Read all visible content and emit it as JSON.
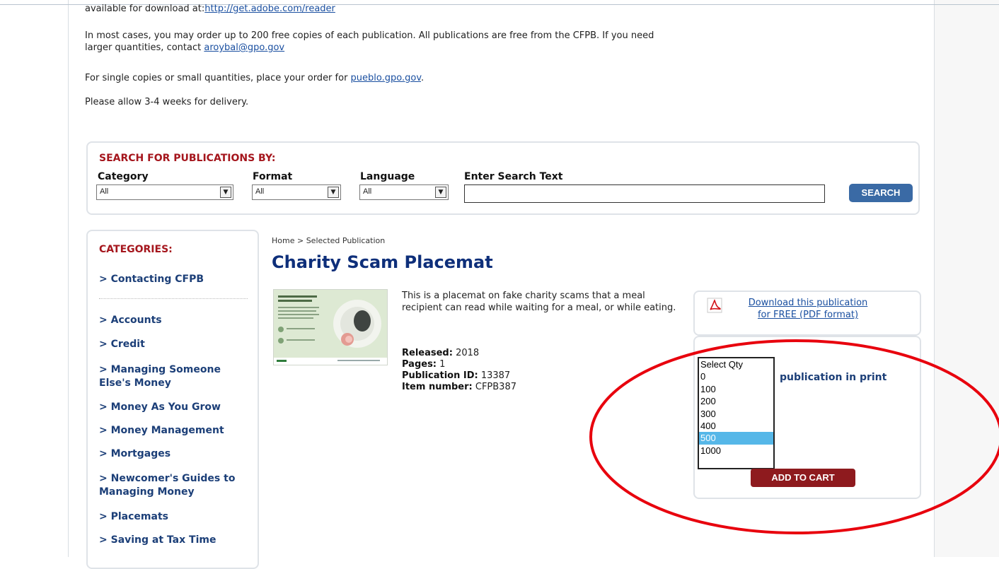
{
  "intro": {
    "reader_prefix": "available for download at:",
    "reader_link": "http://get.adobe.com/reader",
    "order_line1": "In most cases, you may order up to 200 free copies of each publication. All publications are free from the CFPB. If you need",
    "order_line2_prefix": "larger quantities, contact ",
    "order_contact_link": "aroybal@gpo.gov",
    "single_prefix": "For single copies or small quantities, place your order for ",
    "single_link": "pueblo.gpo.gov",
    "single_suffix": ".",
    "delivery": "Please allow 3-4 weeks for delivery."
  },
  "search": {
    "heading": "SEARCH FOR PUBLICATIONS BY:",
    "category_label": "Category",
    "category_value": "All",
    "format_label": "Format",
    "format_value": "All",
    "language_label": "Language",
    "language_value": "All",
    "text_label": "Enter Search Text",
    "text_value": "",
    "button": "SEARCH"
  },
  "categories": {
    "heading": "CATEGORIES:",
    "items": [
      "> Contacting CFPB",
      "> Accounts",
      "> Credit",
      "> Managing Someone Else's Money",
      "> Money As You Grow",
      "> Money Management",
      "> Mortgages",
      "> Newcomer's Guides to Managing Money",
      "> Placemats",
      "> Saving at Tax Time"
    ]
  },
  "publication": {
    "breadcrumb": "Home > Selected Publication",
    "title": "Charity Scam Placemat",
    "description": "This is a placemat on fake charity scams that a meal recipient can read while waiting for a meal, or while eating.",
    "released_label": "Released:",
    "released_value": " 2018",
    "pages_label": "Pages:",
    "pages_value": " 1",
    "pubid_label": "Publication ID:",
    "pubid_value": " 13387",
    "item_label": "Item number:",
    "item_value": " CFPB387",
    "download_line1": "Download this publication",
    "download_line2": "for FREE (PDF format)",
    "print_label": "publication in print"
  },
  "quantity": {
    "options": [
      "Select Qty",
      "0",
      "100",
      "200",
      "300",
      "400",
      "500",
      "1000"
    ],
    "selected": "500"
  },
  "cart": {
    "button": "ADD TO CART"
  },
  "colors": {
    "heading_red": "#a5161d",
    "link_blue": "#1a4fa0",
    "title_navy": "#0e2f7a",
    "cart_red": "#8e1a1e",
    "annotation_red": "#e8000d"
  }
}
